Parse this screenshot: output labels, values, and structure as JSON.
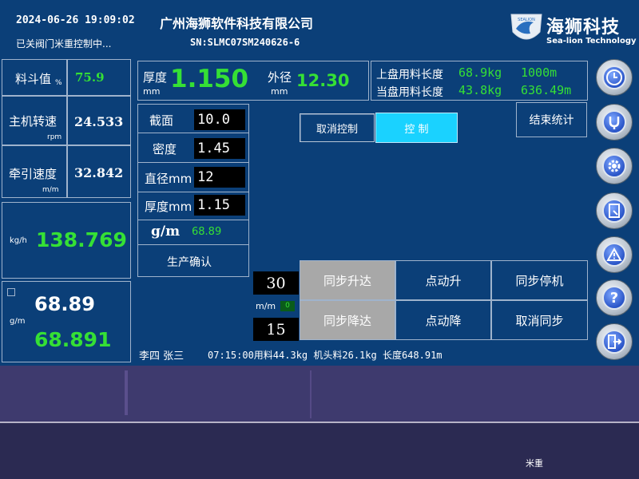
{
  "header": {
    "datetime": "2024-06-26  19:09:02",
    "company": "广州海狮软件科技有限公司",
    "status": "已关阀门米重控制中...",
    "serial": "SN:SLMC07SM240626-6",
    "logo_cn": "海狮科技",
    "logo_en": "Sea-lion Technology",
    "logo_badge": "SEALION"
  },
  "left": {
    "hopper_label": "料斗值",
    "hopper_unit": "%",
    "hopper_value": "75.9",
    "motor_label": "主机转速",
    "motor_unit": "rpm",
    "motor_value": "24.533",
    "traction_label": "牵引速度",
    "traction_unit": "m/m",
    "traction_value": "32.842",
    "kgh_unit": "kg/h",
    "kgh_value": "138.769",
    "gm_unit": "g/m",
    "gm_set": "68.89",
    "gm_actual": "68.891"
  },
  "top": {
    "thickness_label": "厚度",
    "thickness_unit": "mm",
    "thickness_value": "1.150",
    "od_label": "外径",
    "od_unit": "mm",
    "od_value": "12.30",
    "upper_label": "上盘用料长度",
    "upper_weight": "68.9kg",
    "upper_length": "1000m",
    "current_label": "当盘用料长度",
    "current_weight": "43.8kg",
    "current_length": "636.49m"
  },
  "params": {
    "section_label": "截面",
    "section_value": "10.0",
    "density_label": "密度",
    "density_value": "1.45",
    "diameter_label": "直径mm",
    "diameter_value": "12",
    "thickness_label": "厚度mm",
    "thickness_value": "1.15",
    "gm_label": "g/m",
    "gm_value": "68.89",
    "confirm": "生产确认"
  },
  "control": {
    "cancel": "取消控制",
    "control": "控 制",
    "end_stats": "结束统计"
  },
  "sync": {
    "upper_value": "30",
    "unit": "m/m",
    "indicator": "0",
    "lower_value": "15",
    "buttons": [
      "同步升达",
      "点动升",
      "同步停机",
      "同步降达",
      "点动降",
      "取消同步"
    ]
  },
  "footer": {
    "operators": "李四  张三",
    "log": "07:15:00用料44.3kg 机头料26.1kg 长度648.91m"
  },
  "bottom": {
    "label": "米重"
  },
  "colors": {
    "background": "#0b3f78",
    "green": "#35e035",
    "active_button": "#1ad2ff",
    "pressed_button": "#a8a8a8"
  }
}
